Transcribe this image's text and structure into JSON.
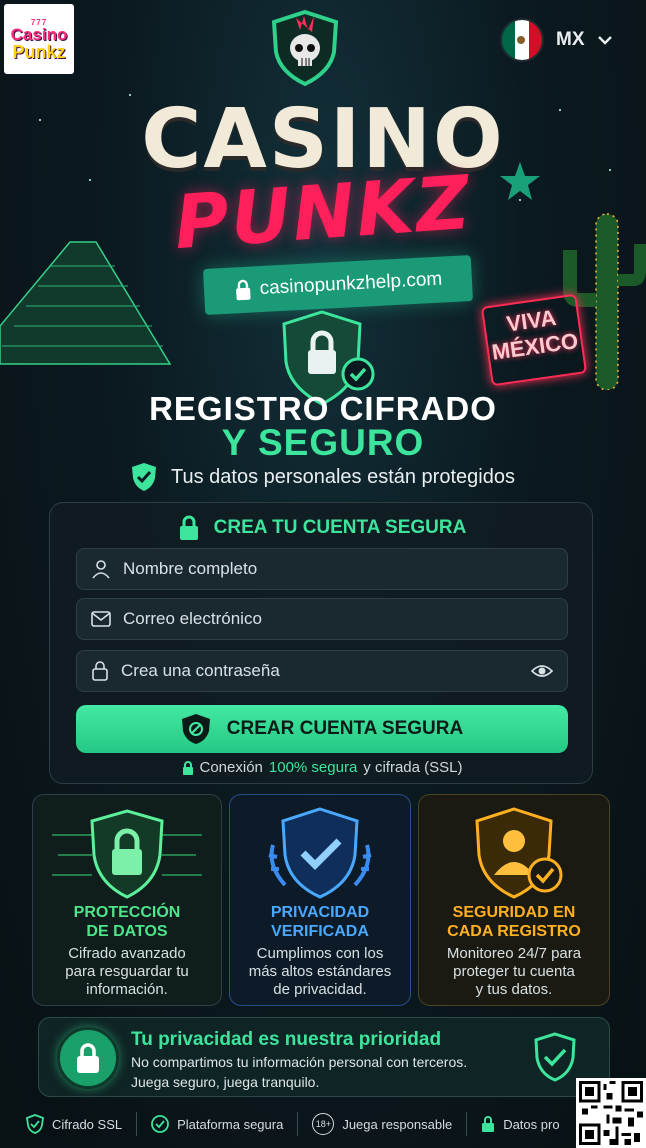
{
  "brand": {
    "logo_line1": "777",
    "logo_line2": "Casino",
    "logo_line3": "Punkz"
  },
  "lang": {
    "code": "MX",
    "flag": [
      "#006847",
      "#ffffff",
      "#ce1126"
    ]
  },
  "hero": {
    "title_top": "CASINO",
    "title_bottom": "PUNKZ",
    "url": "casinopunkzhelp.com",
    "neon_line1": "VIVA",
    "neon_line2": "MÉXICO",
    "heading_line1": "REGISTRO CIFRADO",
    "heading_line2": "Y SEGURO",
    "subtitle": "Tus datos personales están protegidos"
  },
  "form": {
    "title": "CREA TU CUENTA SEGURA",
    "name_placeholder": "Nombre completo",
    "email_placeholder": "Correo electrónico",
    "password_placeholder": "Crea una contraseña",
    "submit_label": "CREAR CUENTA SEGURA",
    "ssl_prefix": "Conexión",
    "ssl_highlight": "100% segura",
    "ssl_suffix": "y cifrada (SSL)"
  },
  "features": [
    {
      "title_l1": "PROTECCIÓN",
      "title_l2": "DE DATOS",
      "desc_l1": "Cifrado avanzado",
      "desc_l2": "para resguardar tu",
      "desc_l3": "información."
    },
    {
      "title_l1": "PRIVACIDAD",
      "title_l2": "VERIFICADA",
      "desc_l1": "Cumplimos con los",
      "desc_l2": "más altos estándares",
      "desc_l3": "de privacidad."
    },
    {
      "title_l1": "SEGURIDAD EN",
      "title_l2": "CADA REGISTRO",
      "desc_l1": "Monitoreo 24/7 para",
      "desc_l2": "proteger tu cuenta",
      "desc_l3": "y tus datos."
    }
  ],
  "privacy": {
    "title": "Tu privacidad es nuestra prioridad",
    "line1": "No compartimos tu información personal con terceros.",
    "line2": "Juega seguro, juega tranquilo."
  },
  "footer": {
    "ssl": "Cifrado SSL",
    "platform": "Plataforma segura",
    "age_badge": "18+",
    "responsible": "Juega responsable",
    "data": "Datos pro"
  },
  "colors": {
    "accent_green": "#3de59c",
    "accent_pink": "#ff1f5a",
    "blue": "#4aa8ff",
    "gold": "#ffb020"
  }
}
